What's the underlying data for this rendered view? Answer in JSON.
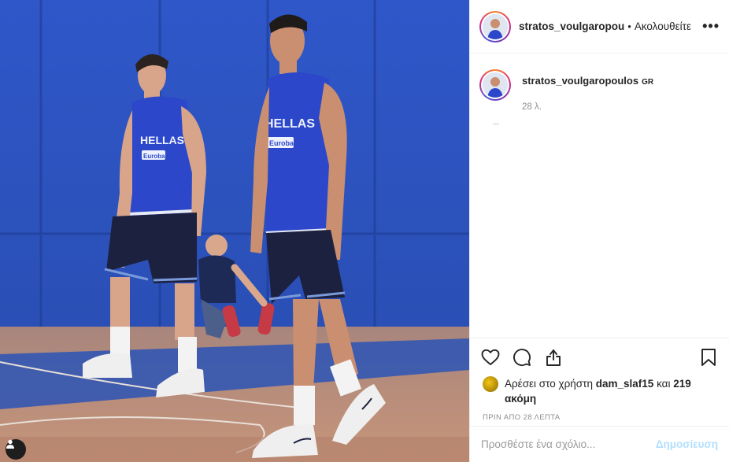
{
  "post": {
    "author": "stratos_voulgaropou",
    "follow_label": "Ακολουθείτε",
    "separator": "•",
    "more_label": "•••"
  },
  "caption": {
    "username": "stratos_voulgaropoulos",
    "text": "GR",
    "time": "28 λ."
  },
  "likes": {
    "prefix": "Αρέσει στο χρήστη",
    "user": "dam_slaf15",
    "joiner": "και",
    "others": "219 ακόμη"
  },
  "posted_ago": "ΠΡΙΝ ΑΠΟ 28 ΛΕΠΤΑ",
  "comment": {
    "placeholder": "Προσθέστε ένα σχόλιο...",
    "publish_label": "Δημοσίευση"
  },
  "photo": {
    "jersey_text": "HELLAS",
    "sponsor_text": "Eurobank"
  },
  "icons": {
    "like": "heart-icon",
    "comment": "comment-icon",
    "share": "share-icon",
    "save": "bookmark-icon",
    "tag": "user-tag-icon"
  },
  "colors": {
    "link_blue_disabled": "#b2dffc",
    "muted_text": "#8e8e8e",
    "border": "#efefef"
  }
}
